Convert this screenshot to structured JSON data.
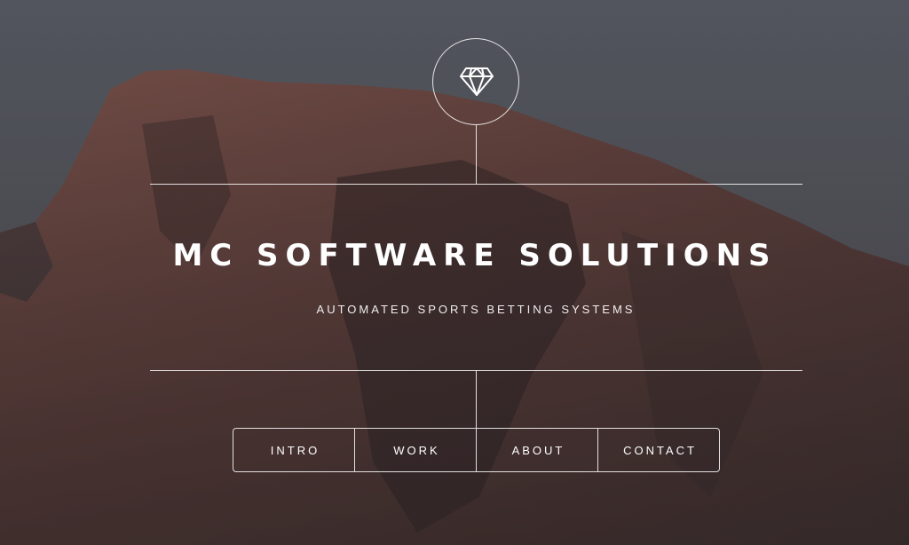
{
  "header": {
    "logo_icon": "diamond-icon",
    "title": "MC SOFTWARE SOLUTIONS",
    "subtitle": "AUTOMATED SPORTS BETTING SYSTEMS"
  },
  "nav": {
    "items": [
      {
        "label": "INTRO"
      },
      {
        "label": "WORK"
      },
      {
        "label": "ABOUT"
      },
      {
        "label": "CONTACT"
      }
    ]
  },
  "colors": {
    "sky": "#5f636c",
    "rock": "#7a4f47",
    "rock_dark": "#3b2a2a",
    "line": "#ffffff"
  }
}
